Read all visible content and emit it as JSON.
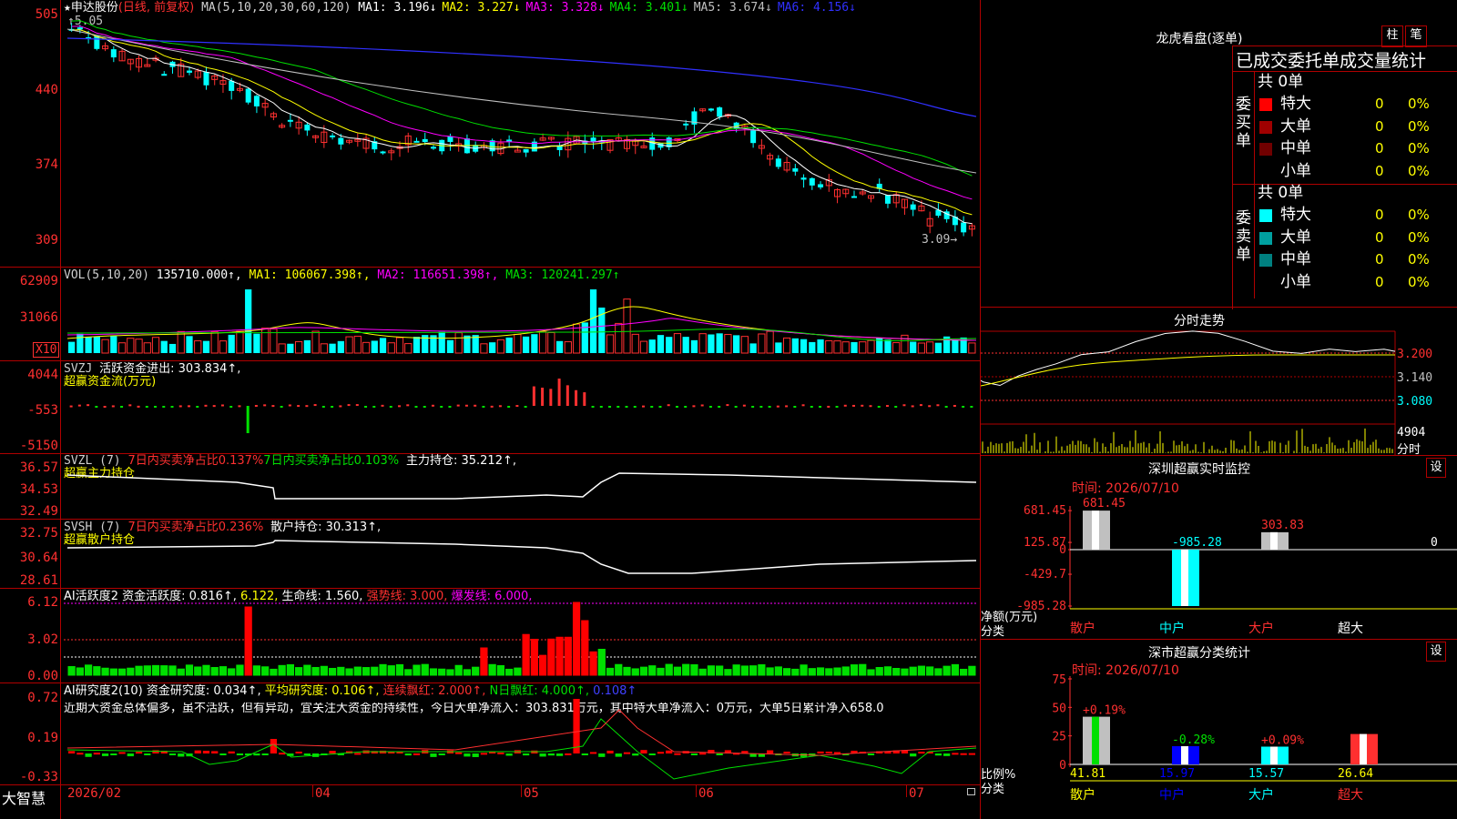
{
  "stock": {
    "marker": "★",
    "name": "申达股份",
    "mode": "(日线, 前复权)"
  },
  "main": {
    "ma_prefix": "MA(5,10,20,30,60,120)",
    "ma": [
      {
        "name": "MA1:",
        "value": "3.196↓",
        "color": "#ffffff"
      },
      {
        "name": "MA2:",
        "value": "3.227↓",
        "color": "#ffff00"
      },
      {
        "name": "MA3:",
        "value": "3.328↓",
        "color": "#ff00ff"
      },
      {
        "name": "MA4:",
        "value": "3.401↓",
        "color": "#00e000"
      },
      {
        "name": "MA5:",
        "value": "3.674↓",
        "color": "#c0c0c0"
      },
      {
        "name": "MA6:",
        "value": "4.156↓",
        "color": "#3030ff"
      }
    ],
    "high_label": "5.05",
    "low_label": "3.09",
    "y_ticks": [
      "505",
      "440",
      "374",
      "309"
    ]
  },
  "vol": {
    "title": "VOL(5,10,20)",
    "value": "135710.000↑,",
    "ma1": "MA1: 106067.398↑,",
    "ma2": "MA2: 116651.398↑,",
    "ma3": "MA3: 120241.297↑",
    "y_ticks": [
      "62909",
      "31066"
    ],
    "unit": "X10"
  },
  "svzj": {
    "title": "SVZJ",
    "text": "活跃资金进出: 303.834↑,",
    "subtitle": "超赢资金流(万元)",
    "y_ticks": [
      "4044",
      "-553",
      "-5150"
    ]
  },
  "svzl": {
    "title": "SVZL (7)",
    "a": "7日内买卖净占比0.137%",
    "b": "7日内买卖净占比0.103%",
    "c": "主力持仓: 35.212↑,",
    "subtitle": "超赢主力持仓",
    "y_ticks": [
      "36.57",
      "34.53",
      "32.49"
    ]
  },
  "svsh": {
    "title": "SVSH (7)",
    "a": "7日内买卖净占比0.236%",
    "c": "散户持仓: 30.313↑,",
    "subtitle": "超赢散户持仓",
    "y_ticks": [
      "32.75",
      "30.64",
      "28.61"
    ]
  },
  "ai": {
    "title": "AI活跃度2",
    "a": "资金活跃度: 0.816↑,",
    "b": "6.122,",
    "c": "生命线: 1.560,",
    "d": "强势线: 3.000,",
    "e": "爆发线: 6.000,",
    "y_ticks": [
      "6.12",
      "3.02",
      "0.00"
    ]
  },
  "res": {
    "title": "AI研究度2(10)",
    "a": "资金研究度: 0.034↑,",
    "b": "平均研究度: 0.106↑,",
    "c": "连续飘红: 2.000↑,",
    "d": "N日飘红: 4.000↑,",
    "e": "0.108↑",
    "comment": "近期大资金总体偏多，虽不活跃，但有异动，宜关注大资金的持续性，今日大单净流入：303.831万元，其中特大单净流入：0万元，大单5日累计净入658.0",
    "y_ticks": [
      "0.72",
      "0.19",
      "-0.33"
    ]
  },
  "xaxis": {
    "brand": "大智慧",
    "labels": [
      "2026/02",
      "04",
      "05",
      "06",
      "07"
    ]
  },
  "lhb": {
    "title": "龙虎看盘(逐单)",
    "btn_zhu": "柱",
    "btn_bi": "笔",
    "header": "已成交委托单成交量统计",
    "buy_label": "委买单",
    "sell_label": "委卖单",
    "buy_total": "共 0单",
    "sell_total": "共 0单",
    "buy_rows": [
      {
        "label": "特大",
        "count": "0",
        "pct": "0%",
        "color": "#ff0000"
      },
      {
        "label": "大单",
        "count": "0",
        "pct": "0%",
        "color": "#a00000"
      },
      {
        "label": "中单",
        "count": "0",
        "pct": "0%",
        "color": "#700000"
      },
      {
        "label": "小单",
        "count": "0",
        "pct": "0%",
        "color": "#000000"
      }
    ],
    "sell_rows": [
      {
        "label": "特大",
        "count": "0",
        "pct": "0%",
        "color": "#00ffff"
      },
      {
        "label": "大单",
        "count": "0",
        "pct": "0%",
        "color": "#00a0a0"
      },
      {
        "label": "中单",
        "count": "0",
        "pct": "0%",
        "color": "#008080"
      },
      {
        "label": "小单",
        "count": "0",
        "pct": "0%",
        "color": "#000000"
      }
    ]
  },
  "intraday": {
    "title": "分时走势",
    "y_ticks": [
      "3.200",
      "3.140",
      "3.080"
    ],
    "vol_label": "4904",
    "vol_unit": "分时"
  },
  "monitor": {
    "title": "深圳超赢实时监控",
    "btn": "设",
    "time": "时间: 2026/07/10",
    "y_ticks": [
      "681.45",
      "125.87",
      "0",
      "-429.7",
      "-985.28"
    ],
    "ylabel": "净额(万元)",
    "xlabel": "分类",
    "categories": [
      "散户",
      "中户",
      "大户",
      "超大"
    ],
    "values": [
      681.45,
      -985.28,
      303.83,
      0
    ],
    "value_labels": [
      "681.45",
      "-985.28",
      "303.83",
      "0"
    ]
  },
  "classify": {
    "title": "深市超赢分类统计",
    "btn": "设",
    "time": "时间: 2026/07/10",
    "y_ticks": [
      "75",
      "50",
      "25",
      "0"
    ],
    "ylabel": "比例%",
    "xlabel": "分类",
    "categories": [
      "散户",
      "中户",
      "大户",
      "超大"
    ],
    "values": [
      41.81,
      15.97,
      15.57,
      26.64
    ],
    "changes": [
      "+0.19%",
      "-0.28%",
      "+0.09%",
      ""
    ],
    "value_labels": [
      "41.81",
      "15.97",
      "15.57",
      "26.64"
    ]
  },
  "colors": {
    "up": "#ff3030",
    "down": "#00ffff",
    "frame": "#b00000"
  }
}
